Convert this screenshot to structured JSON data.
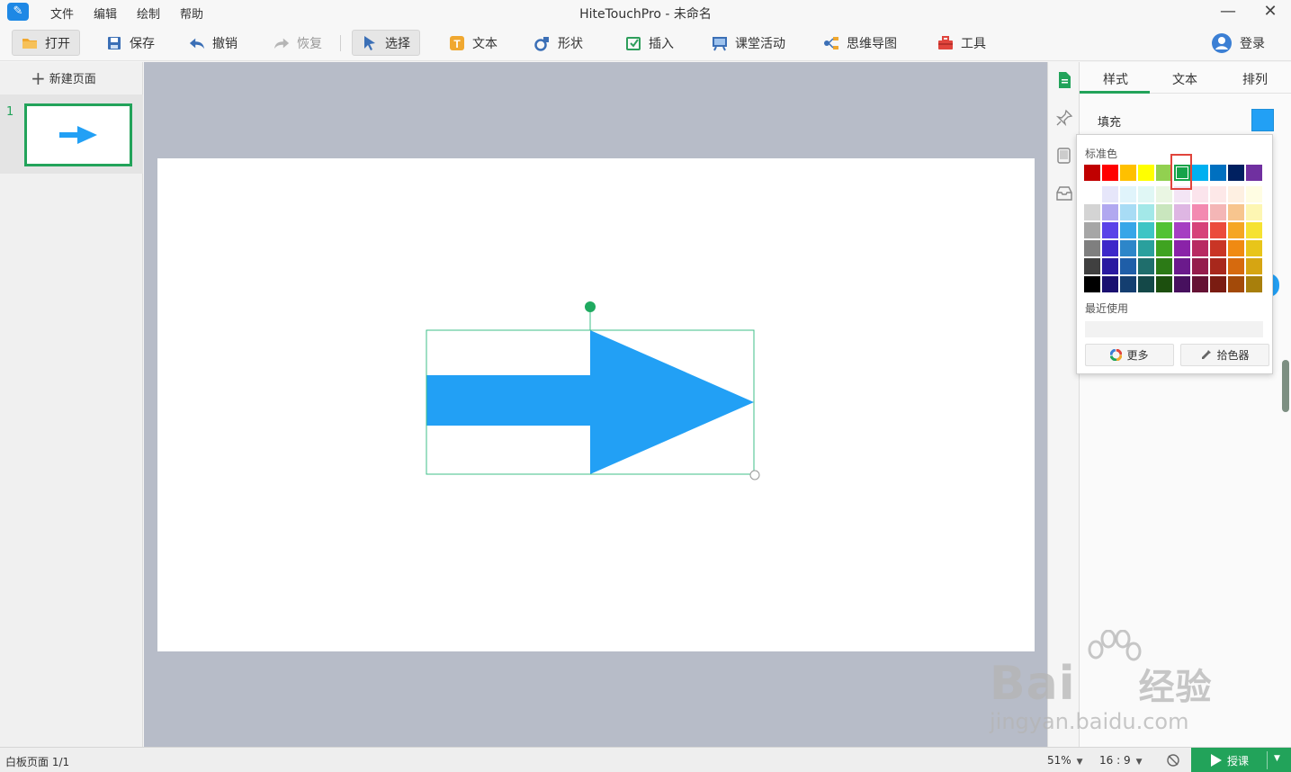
{
  "titlebar": {
    "title": "HiteTouchPro - 未命名",
    "menu": [
      "文件",
      "编辑",
      "绘制",
      "帮助"
    ],
    "minimize": "—",
    "close": "✕"
  },
  "toolbar": {
    "open": "打开",
    "save": "保存",
    "undo": "撤销",
    "redo": "恢复",
    "select": "选择",
    "text": "文本",
    "shape": "形状",
    "insert": "插入",
    "classroom": "课堂活动",
    "mindmap": "思维导图",
    "tools": "工具",
    "login": "登录"
  },
  "left_panel": {
    "new_page": "新建页面",
    "page_number": "1"
  },
  "right_panel": {
    "tabs": [
      "样式",
      "文本",
      "排列"
    ],
    "fill_label": "填充",
    "fill_color": "#22a0f5"
  },
  "color_popup": {
    "standard_label": "标准色",
    "recent_label": "最近使用",
    "more_button": "更多",
    "eyedropper_button": "拾色器",
    "selected_color": "#16a34a",
    "standard_colors": [
      "#c00000",
      "#ff0000",
      "#ffc000",
      "#ffff00",
      "#92d050",
      "#16a34a",
      "#00b0f0",
      "#0070c0",
      "#002060",
      "#7030a0"
    ],
    "shades": [
      [
        "#ffffff",
        "#e6e6fa",
        "#e0f4fb",
        "#e0f7f5",
        "#eaf6e3",
        "#f3e5f5",
        "#fbe4ec",
        "#fde8e8",
        "#fef0e2",
        "#fffde3"
      ],
      [
        "#d4d4d4",
        "#b1a8f0",
        "#a8dcf5",
        "#a3e8e8",
        "#c9e6be",
        "#deb6e3",
        "#f38ab1",
        "#f4b6b6",
        "#f7c58e",
        "#fdf6b2"
      ],
      [
        "#a6a6a6",
        "#5a43e8",
        "#37a6e8",
        "#3ec5c5",
        "#52c234",
        "#a63fc2",
        "#d6427a",
        "#eb4b3c",
        "#f5a623",
        "#f6e232"
      ],
      [
        "#7f7f7f",
        "#3d28c9",
        "#2d86c9",
        "#2aa09d",
        "#3fa321",
        "#8a23a8",
        "#b82a62",
        "#c93525",
        "#f08a12",
        "#e8c51a"
      ],
      [
        "#404040",
        "#2a1aa0",
        "#1f5ea8",
        "#1f6e6c",
        "#2c7a16",
        "#6b1a8c",
        "#951d4d",
        "#a8281c",
        "#d66a0e",
        "#d6a512"
      ],
      [
        "#000000",
        "#1a1070",
        "#143e70",
        "#144848",
        "#1c4f0e",
        "#47105e",
        "#651234",
        "#7a1c12",
        "#a34a09",
        "#a87f0c"
      ]
    ]
  },
  "statusbar": {
    "page_info": "白板页面 1/1",
    "zoom": "51%",
    "ratio": "16 : 9",
    "teach": "授课"
  },
  "watermark": {
    "brand": "Bai",
    "brand_cn": "经验",
    "url": "jingyan.baidu.com"
  }
}
